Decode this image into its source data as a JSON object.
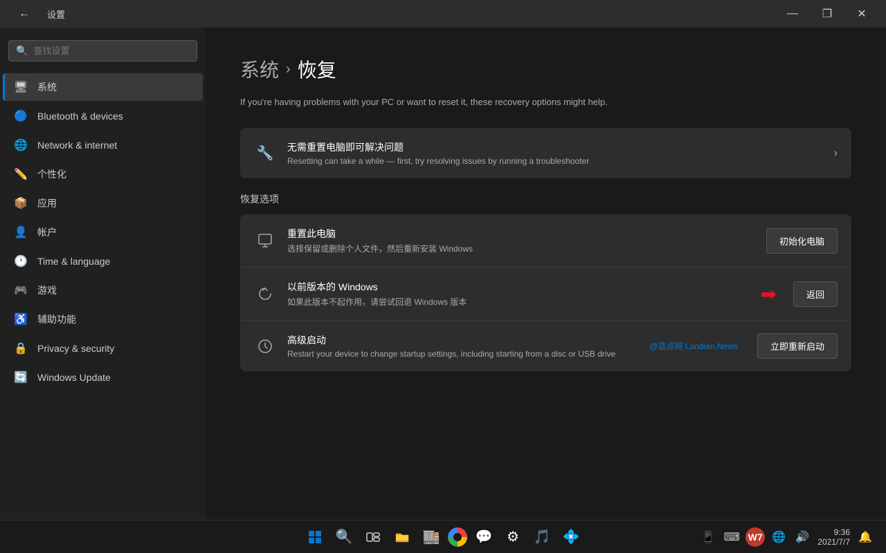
{
  "titleBar": {
    "title": "设置",
    "backArrow": "←",
    "minimize": "—",
    "maximize": "❐",
    "close": "✕"
  },
  "sidebar": {
    "searchPlaceholder": "查找设置",
    "searchIcon": "🔍",
    "navItems": [
      {
        "id": "system",
        "label": "系统",
        "icon": "🖥",
        "active": true
      },
      {
        "id": "bluetooth",
        "label": "Bluetooth & devices",
        "icon": "🔵",
        "active": false
      },
      {
        "id": "network",
        "label": "Network & internet",
        "icon": "🌐",
        "active": false
      },
      {
        "id": "personalization",
        "label": "个性化",
        "icon": "✏️",
        "active": false
      },
      {
        "id": "apps",
        "label": "应用",
        "icon": "📦",
        "active": false
      },
      {
        "id": "accounts",
        "label": "帐户",
        "icon": "👤",
        "active": false
      },
      {
        "id": "time",
        "label": "Time & language",
        "icon": "🕐",
        "active": false
      },
      {
        "id": "gaming",
        "label": "游戏",
        "icon": "🎮",
        "active": false
      },
      {
        "id": "accessibility",
        "label": "辅助功能",
        "icon": "♿",
        "active": false
      },
      {
        "id": "privacy",
        "label": "Privacy & security",
        "icon": "🔒",
        "active": false
      },
      {
        "id": "update",
        "label": "Windows Update",
        "icon": "🔄",
        "active": false
      }
    ]
  },
  "content": {
    "breadcrumb": {
      "parent": "系统",
      "separator": "›",
      "current": "恢复"
    },
    "description": "If you're having problems with your PC or want to reset it, these recovery options might help.",
    "troubleshooterCard": {
      "icon": "🔧",
      "title": "无需重置电脑即可解决问题",
      "subtitle": "Resetting can take a while — first, try resolving issues by running a troubleshooter",
      "chevron": "›"
    },
    "recoverySection": {
      "title": "恢复选项",
      "items": [
        {
          "icon": "💻",
          "title": "重置此电脑",
          "subtitle": "选择保留或删除个人文件，然后重新安装 Windows",
          "buttonLabel": "初始化电脑",
          "hasArrow": false
        },
        {
          "icon": "🔙",
          "title": "以前版本的 Windows",
          "subtitle": "如果此版本不起作用，请尝试回退 Windows 版本",
          "buttonLabel": "返回",
          "hasArrow": true
        },
        {
          "icon": "⚡",
          "title": "高级启动",
          "subtitle": "Restart your device to change startup settings, including starting from a disc or USB drive",
          "buttonLabel": "立即重新启动",
          "hasArrow": false
        }
      ]
    }
  },
  "watermark": "@蓝点网 Landian.News",
  "taskbar": {
    "time": "9:36",
    "date": "2021/7/7",
    "icons": [
      "⊞",
      "🔍",
      "🗂",
      "📁",
      "🏬",
      "🌐",
      "💬",
      "⚙",
      "🎵",
      "💠"
    ]
  }
}
